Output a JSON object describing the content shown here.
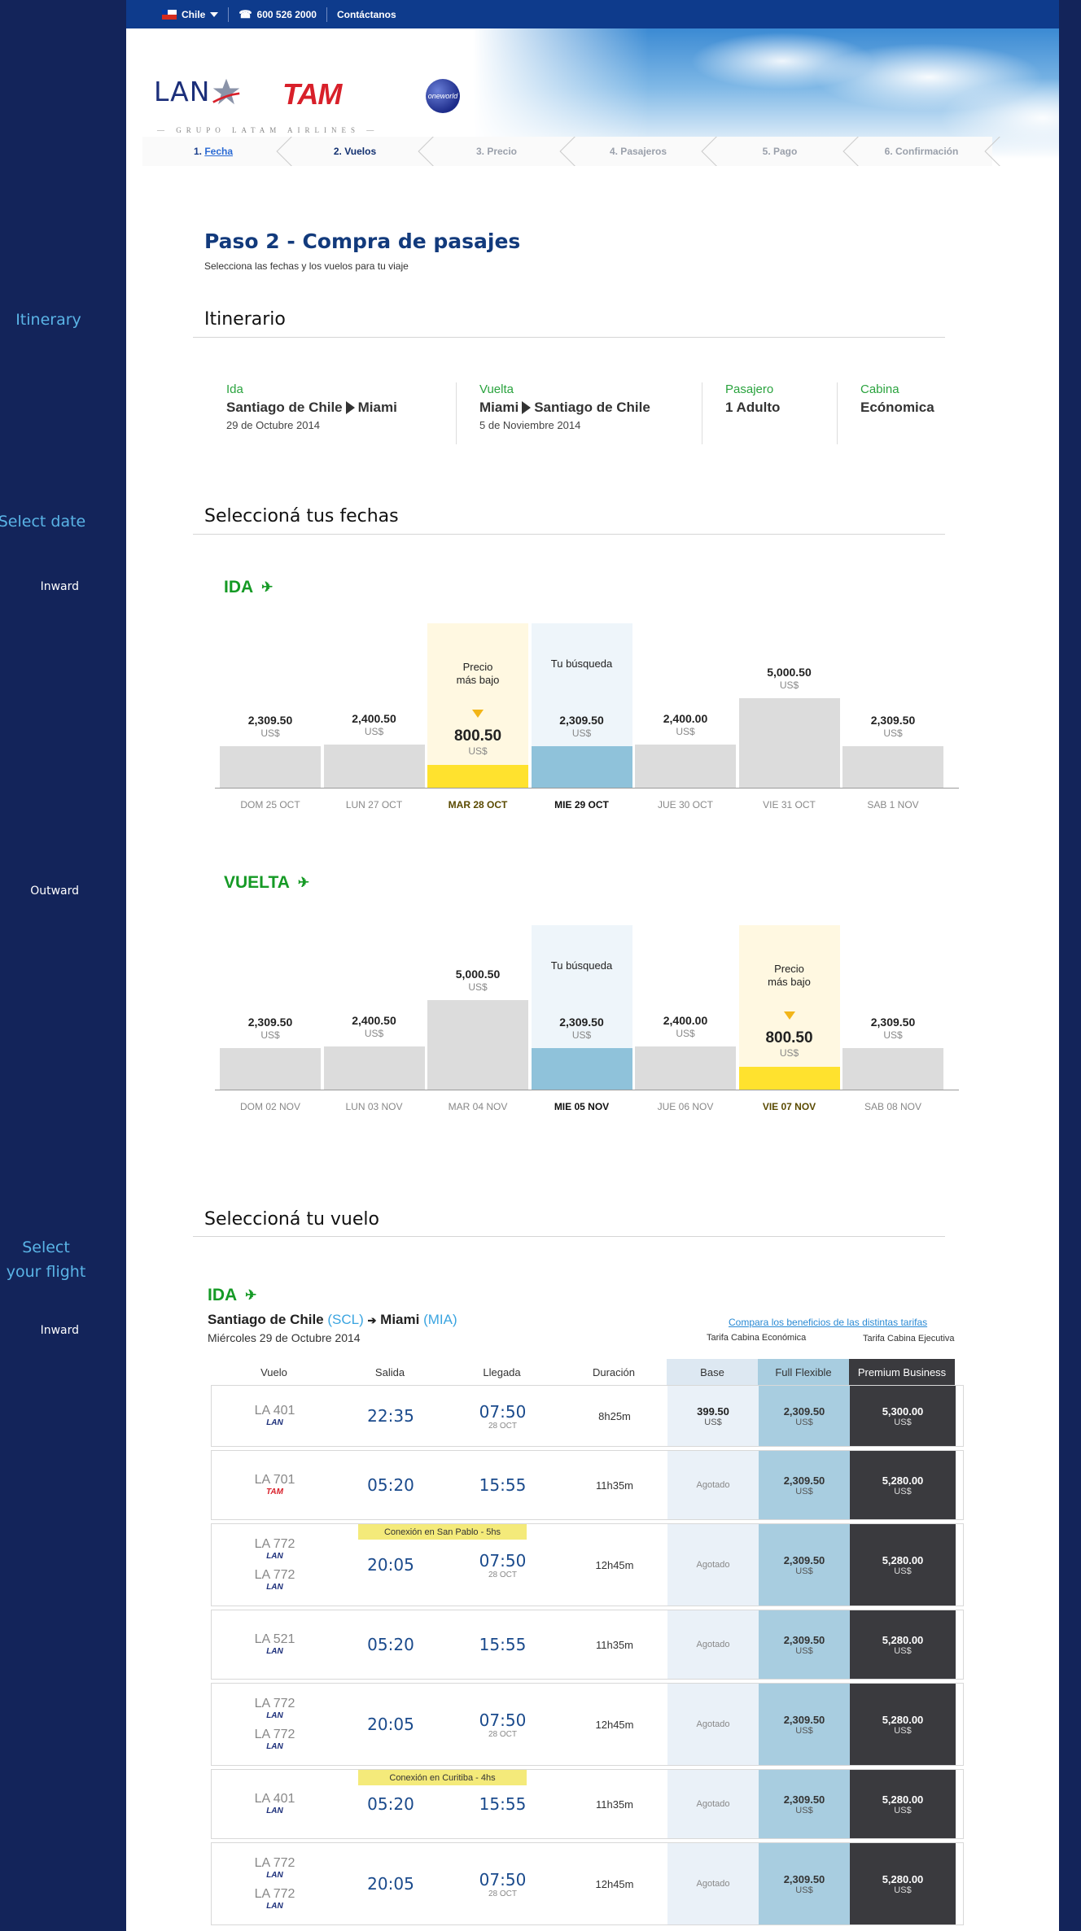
{
  "annotations": {
    "itinerary": "Itinerary",
    "select_date": "Select date",
    "inward_1": "Inward",
    "outward": "Outward",
    "select_flight_1": "Select",
    "select_flight_2": "your flight",
    "inward_2": "Inward"
  },
  "topbar": {
    "country": "Chile",
    "phone": "600 526 2000",
    "contact": "Contáctanos"
  },
  "brand": {
    "lan": "LAN",
    "tam": "TAM",
    "latam": "— GRUPO LATAM AIRLINES —",
    "oneworld": "oneworld"
  },
  "steps": [
    {
      "num": "1.",
      "label": "Fecha"
    },
    {
      "label": "2. Vuelos"
    },
    {
      "label": "3. Precio"
    },
    {
      "label": "4. Pasajeros"
    },
    {
      "label": "5. Pago"
    },
    {
      "label": "6. Confirmación"
    }
  ],
  "page": {
    "title": "Paso 2 - Compra de pasajes",
    "subtitle": "Selecciona las fechas y los vuelos para tu viaje"
  },
  "itinerary": {
    "heading": "Itinerario",
    "ida": {
      "label": "Ida",
      "from": "Santiago de Chile",
      "to": "Miami",
      "date": "29 de Octubre 2014"
    },
    "vuelta": {
      "label": "Vuelta",
      "from": "Miami",
      "to": "Santiago de Chile",
      "date": "5 de Noviembre 2014"
    },
    "pasajero": {
      "label": "Pasajero",
      "value": "1 Adulto"
    },
    "cabina": {
      "label": "Cabina",
      "value": "Ecónomica"
    }
  },
  "dates": {
    "heading": "Seleccioná tus fechas",
    "currency": "US$",
    "tag_lowest_1": "Precio",
    "tag_lowest_2": "más bajo",
    "tag_search": "Tu búsqueda",
    "ida": {
      "label": "IDA",
      "days": [
        {
          "date": "DOM 25 OCT",
          "price": "2,309.50",
          "value": 2309.5,
          "kind": "normal"
        },
        {
          "date": "LUN 27 OCT",
          "price": "2,400.50",
          "value": 2400.5,
          "kind": "normal"
        },
        {
          "date": "MAR 28 OCT",
          "price": "800.50",
          "value": 800.5,
          "kind": "lowest"
        },
        {
          "date": "MIE 29 OCT",
          "price": "2,309.50",
          "value": 2309.5,
          "kind": "search"
        },
        {
          "date": "JUE 30 OCT",
          "price": "2,400.00",
          "value": 2400.0,
          "kind": "normal"
        },
        {
          "date": "VIE 31 OCT",
          "price": "5,000.50",
          "value": 5000.5,
          "kind": "normal"
        },
        {
          "date": "SAB 1 NOV",
          "price": "2,309.50",
          "value": 2309.5,
          "kind": "normal"
        }
      ]
    },
    "vuelta": {
      "label": "VUELTA",
      "days": [
        {
          "date": "DOM 02 NOV",
          "price": "2,309.50",
          "value": 2309.5,
          "kind": "normal"
        },
        {
          "date": "LUN 03 NOV",
          "price": "2,400.50",
          "value": 2400.5,
          "kind": "normal"
        },
        {
          "date": "MAR 04 NOV",
          "price": "5,000.50",
          "value": 5000.5,
          "kind": "normal"
        },
        {
          "date": "MIE 05 NOV",
          "price": "2,309.50",
          "value": 2309.5,
          "kind": "search"
        },
        {
          "date": "JUE 06 NOV",
          "price": "2,400.00",
          "value": 2400.0,
          "kind": "normal"
        },
        {
          "date": "VIE 07 NOV",
          "price": "800.50",
          "value": 800.5,
          "kind": "lowest"
        },
        {
          "date": "SAB 08 NOV",
          "price": "2,309.50",
          "value": 2309.5,
          "kind": "normal"
        }
      ]
    }
  },
  "flights": {
    "heading": "Seleccioná tu vuelo",
    "direction": "IDA",
    "route_from": "Santiago de Chile",
    "route_from_code": "(SCL)",
    "route_to": "Miami",
    "route_to_code": "(MIA)",
    "date": "Miércoles 29 de Octubre 2014",
    "compare_link": "Compara los beneficios de las distintas tarifas",
    "cabin_economy": "Tarifa Cabina Económica",
    "cabin_exec": "Tarifa Cabina Ejecutiva",
    "columns": [
      "Vuelo",
      "Salida",
      "Llegada",
      "Duración",
      "Base",
      "Full Flexible",
      "Premium Business"
    ],
    "currency": "US$",
    "sold_out": "Agotado",
    "rows": [
      {
        "flights": [
          {
            "num": "LA 401",
            "airline": "LAN"
          }
        ],
        "dep": "22:35",
        "arr": "07:50",
        "arr_note": "28 OCT",
        "dur": "8h25m",
        "base": "399.50",
        "flex": "2,309.50",
        "prem": "5,300.00",
        "conn": ""
      },
      {
        "flights": [
          {
            "num": "LA 701",
            "airline": "TAM"
          }
        ],
        "dep": "05:20",
        "arr": "15:55",
        "arr_note": "",
        "dur": "11h35m",
        "base": "",
        "flex": "2,309.50",
        "prem": "5,280.00",
        "conn": ""
      },
      {
        "flights": [
          {
            "num": "LA 772",
            "airline": "LAN"
          },
          {
            "num": "LA 772",
            "airline": "LAN"
          }
        ],
        "dep": "20:05",
        "arr": "07:50",
        "arr_note": "28 OCT",
        "dur": "12h45m",
        "base": "",
        "flex": "2,309.50",
        "prem": "5,280.00",
        "conn": "Conexión en San Pablo - 5hs"
      },
      {
        "flights": [
          {
            "num": "LA 521",
            "airline": "LAN"
          }
        ],
        "dep": "05:20",
        "arr": "15:55",
        "arr_note": "",
        "dur": "11h35m",
        "base": "",
        "flex": "2,309.50",
        "prem": "5,280.00",
        "conn": ""
      },
      {
        "flights": [
          {
            "num": "LA 772",
            "airline": "LAN"
          },
          {
            "num": "LA 772",
            "airline": "LAN"
          }
        ],
        "dep": "20:05",
        "arr": "07:50",
        "arr_note": "28 OCT",
        "dur": "12h45m",
        "base": "",
        "flex": "2,309.50",
        "prem": "5,280.00",
        "conn": ""
      },
      {
        "flights": [
          {
            "num": "LA 401",
            "airline": "LAN"
          }
        ],
        "dep": "05:20",
        "arr": "15:55",
        "arr_note": "",
        "dur": "11h35m",
        "base": "",
        "flex": "2,309.50",
        "prem": "5,280.00",
        "conn": "Conexión en Curitiba - 4hs"
      },
      {
        "flights": [
          {
            "num": "LA 772",
            "airline": "LAN"
          },
          {
            "num": "LA 772",
            "airline": "LAN"
          }
        ],
        "dep": "20:05",
        "arr": "07:50",
        "arr_note": "28 OCT",
        "dur": "12h45m",
        "base": "",
        "flex": "2,309.50",
        "prem": "5,280.00",
        "conn": ""
      }
    ]
  }
}
